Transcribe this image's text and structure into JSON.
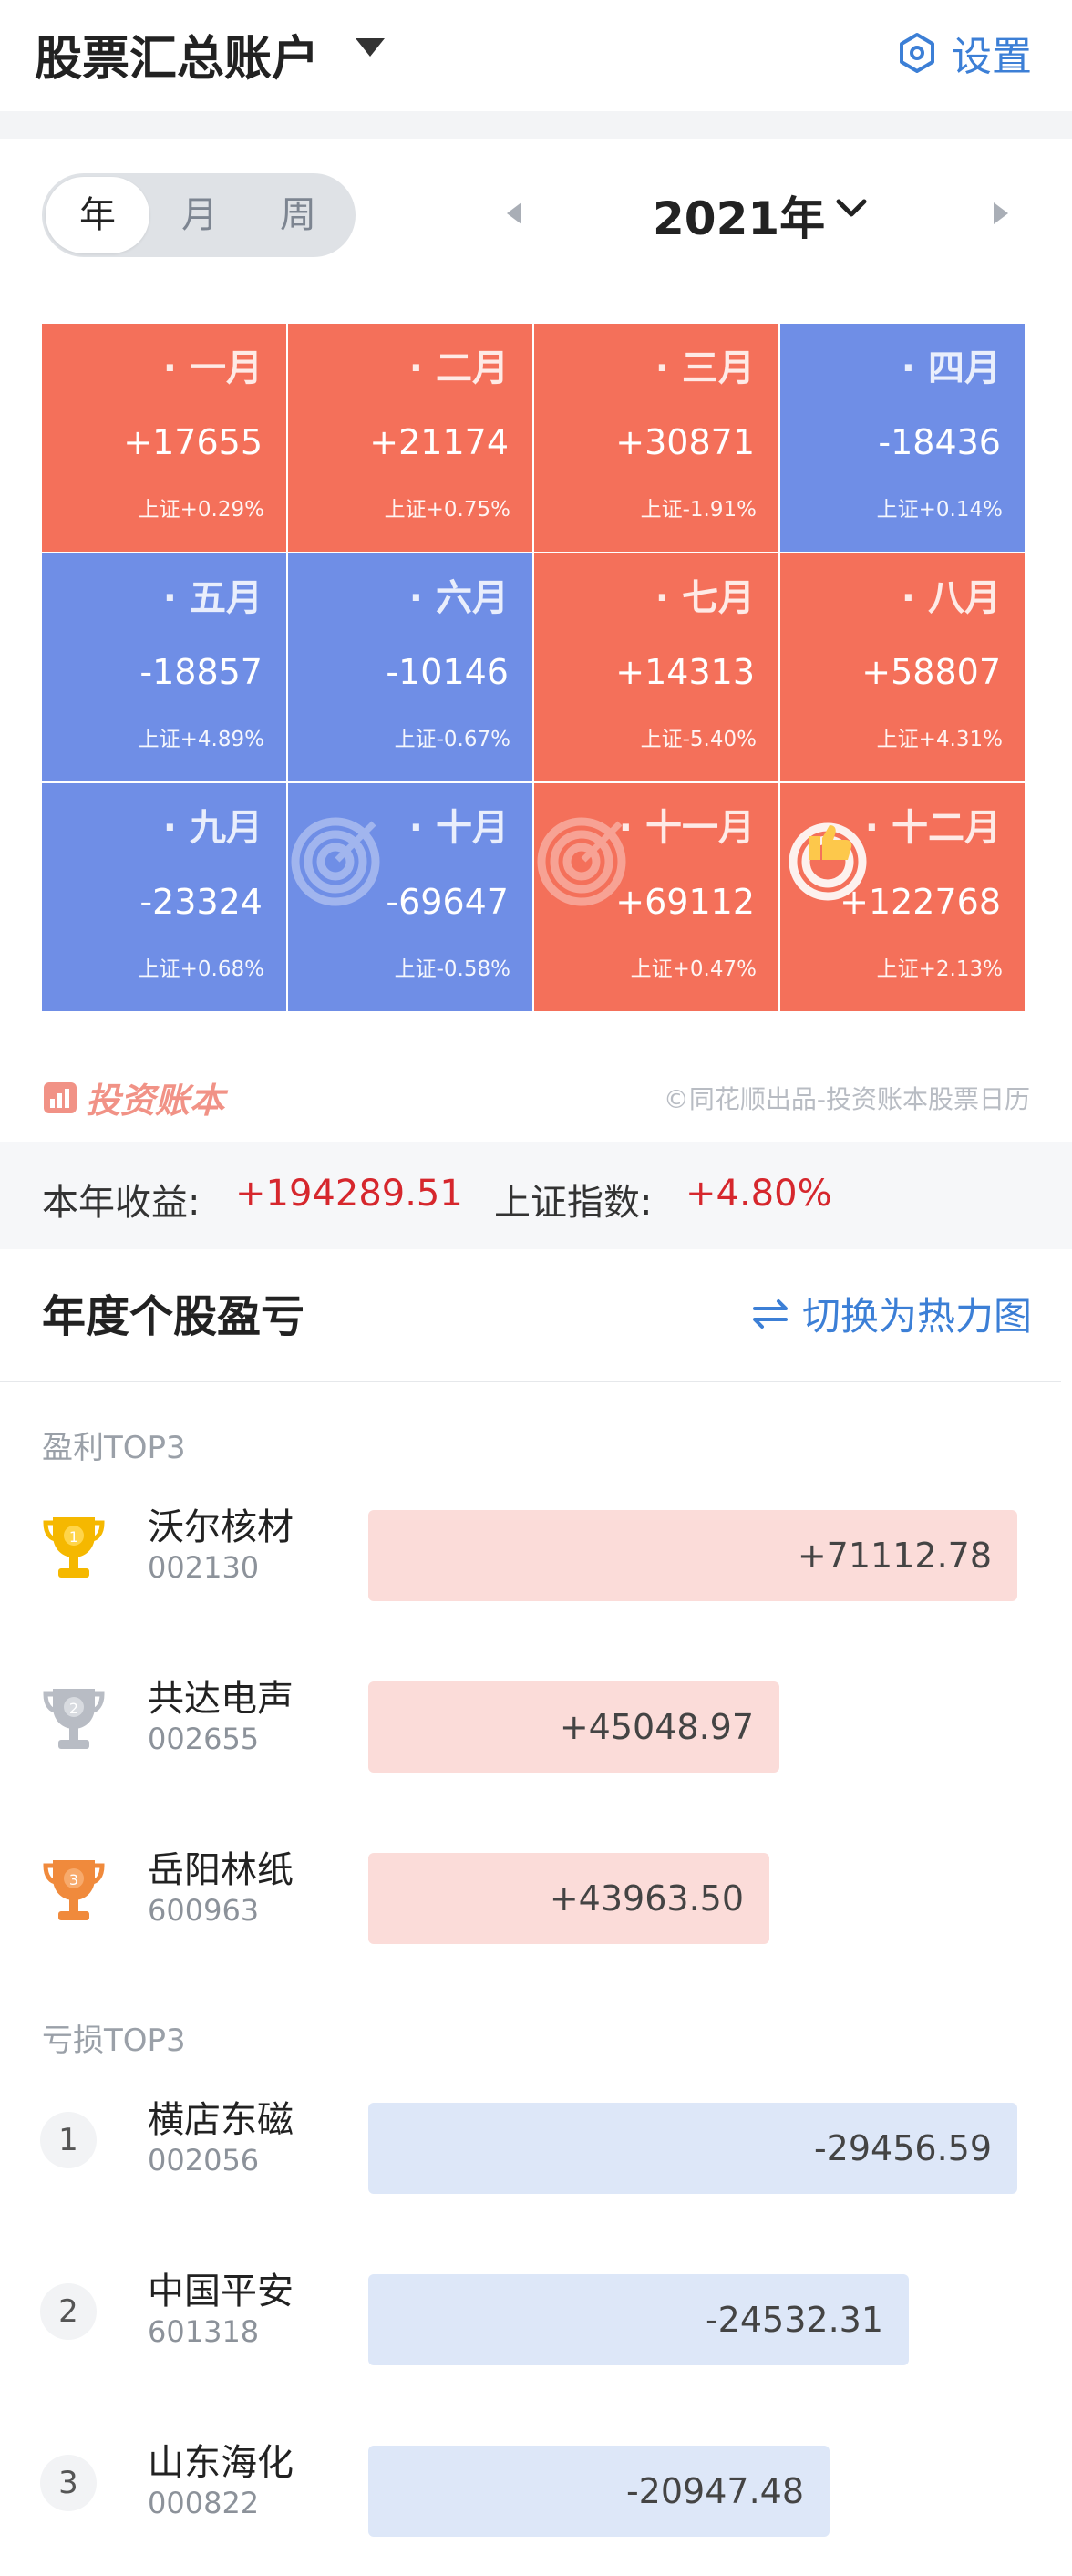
{
  "header": {
    "title": "股票汇总账户",
    "settings_label": "设置"
  },
  "period": {
    "tabs": [
      "年",
      "月",
      "周"
    ],
    "active": "年",
    "year_label": "2021年"
  },
  "months": [
    {
      "name": "一月",
      "value": "+17655",
      "index": "上证+0.29%",
      "trend": "up"
    },
    {
      "name": "二月",
      "value": "+21174",
      "index": "上证+0.75%",
      "trend": "up"
    },
    {
      "name": "三月",
      "value": "+30871",
      "index": "上证-1.91%",
      "trend": "up"
    },
    {
      "name": "四月",
      "value": "-18436",
      "index": "上证+0.14%",
      "trend": "down"
    },
    {
      "name": "五月",
      "value": "-18857",
      "index": "上证+4.89%",
      "trend": "down"
    },
    {
      "name": "六月",
      "value": "-10146",
      "index": "上证-0.67%",
      "trend": "down"
    },
    {
      "name": "七月",
      "value": "+14313",
      "index": "上证-5.40%",
      "trend": "up"
    },
    {
      "name": "八月",
      "value": "+58807",
      "index": "上证+4.31%",
      "trend": "up"
    },
    {
      "name": "九月",
      "value": "-23324",
      "index": "上证+0.68%",
      "trend": "down"
    },
    {
      "name": "十月",
      "value": "-69647",
      "index": "上证-0.58%",
      "trend": "down",
      "badge": "target-icon"
    },
    {
      "name": "十一月",
      "value": "+69112",
      "index": "上证+0.47%",
      "trend": "up",
      "badge": "target-icon"
    },
    {
      "name": "十二月",
      "value": "+122768",
      "index": "上证+2.13%",
      "trend": "up",
      "badge": "thumbs-up-icon"
    }
  ],
  "colors": {
    "up": "#f4705a",
    "down": "#6f8ee6",
    "accent": "#3c7fd6",
    "gain_text": "#d6272d"
  },
  "watermark": {
    "brand": "投资账本",
    "credit": "©同花顺出品-投资账本股票日历"
  },
  "summary": {
    "year_profit_label": "本年收益:",
    "year_profit_value": "+194289.51",
    "index_label": "上证指数:",
    "index_value": "+4.80%"
  },
  "section": {
    "title": "年度个股盈亏",
    "switch_label": "切换为热力图"
  },
  "profit_top3": {
    "label": "盈利TOP3",
    "items": [
      {
        "rank": "1",
        "name": "沃尔核材",
        "code": "002130",
        "value": "+71112.78",
        "share": 1.0,
        "medal": "gold-trophy-icon"
      },
      {
        "rank": "2",
        "name": "共达电声",
        "code": "002655",
        "value": "+45048.97",
        "share": 0.6335,
        "medal": "silver-trophy-icon"
      },
      {
        "rank": "3",
        "name": "岳阳林纸",
        "code": "600963",
        "value": "+43963.50",
        "share": 0.6182,
        "medal": "bronze-trophy-icon"
      }
    ]
  },
  "loss_top3": {
    "label": "亏损TOP3",
    "items": [
      {
        "rank": "1",
        "name": "横店东磁",
        "code": "002056",
        "value": "-29456.59",
        "share": 1.0
      },
      {
        "rank": "2",
        "name": "中国平安",
        "code": "601318",
        "value": "-24532.31",
        "share": 0.8328
      },
      {
        "rank": "3",
        "name": "山东海化",
        "code": "000822",
        "value": "-20947.48",
        "share": 0.7111
      }
    ]
  }
}
